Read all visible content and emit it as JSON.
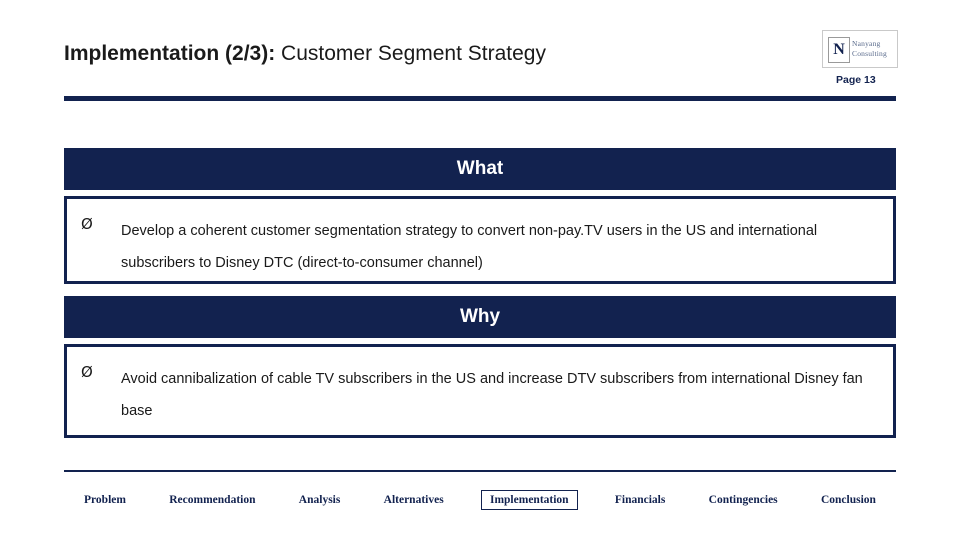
{
  "header": {
    "title_bold": "Implementation (2/3):",
    "title_rest": " Customer Segment Strategy",
    "page_label": "Page 13",
    "logo": {
      "letter": "N",
      "line1": "Nanyang",
      "line2": "Consulting"
    }
  },
  "sections": [
    {
      "heading": "What",
      "bullet_mark": "Ø",
      "text": "Develop a coherent customer segmentation strategy to convert non-pay.TV users in the US and international subscribers to Disney DTC (direct-to-consumer channel)"
    },
    {
      "heading": "Why",
      "bullet_mark": "Ø",
      "text": "Avoid cannibalization of cable TV subscribers in the US and increase DTV subscribers from international Disney fan base"
    }
  ],
  "footer_nav": [
    {
      "label": "Problem",
      "active": false
    },
    {
      "label": "Recommendation",
      "active": false
    },
    {
      "label": "Analysis",
      "active": false
    },
    {
      "label": "Alternatives",
      "active": false
    },
    {
      "label": "Implementation",
      "active": true
    },
    {
      "label": "Financials",
      "active": false
    },
    {
      "label": "Contingencies",
      "active": false
    },
    {
      "label": "Conclusion",
      "active": false
    }
  ],
  "colors": {
    "navy": "#12224f",
    "white": "#ffffff"
  }
}
